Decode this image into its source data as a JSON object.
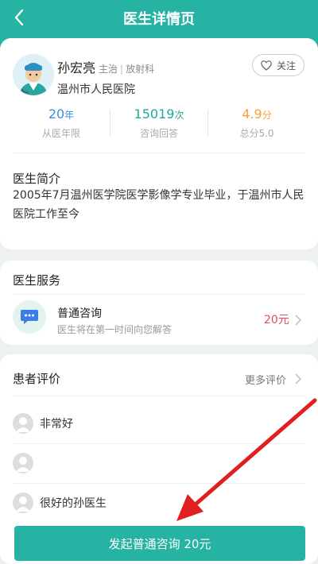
{
  "header": {
    "title": "医生详情页",
    "back_icon": "chevron-left-icon"
  },
  "doctor": {
    "name": "孙宏亮",
    "title": "主治",
    "department": "放射科",
    "hospital": "温州市人民医院",
    "follow_label": "关注"
  },
  "stats": [
    {
      "value": "20",
      "unit": "年",
      "label": "从医年限",
      "color": "#3b8fe0"
    },
    {
      "value": "15019",
      "unit": "次",
      "label": "咨询回答",
      "color": "#1ea99a"
    },
    {
      "value": "4.9",
      "unit": "分",
      "label": "总分5.0",
      "color": "#f2a23a"
    }
  ],
  "intro": {
    "title": "医生简介",
    "text": "2005年7月温州医学院医学影像学专业毕业，于温州市人民医院工作至今"
  },
  "services": {
    "title": "医生服务",
    "items": [
      {
        "name": "普通咨询",
        "desc": "医生将在第一时间向您解答",
        "price": "20元"
      }
    ]
  },
  "reviews": {
    "title": "患者评价",
    "more_label": "更多评价",
    "items": [
      {
        "text": "非常好"
      },
      {
        "text": ""
      },
      {
        "text": "很好的孙医生"
      }
    ]
  },
  "cta": {
    "label": "发起普通咨询 20元"
  },
  "colors": {
    "brand": "#26b3a3",
    "price": "#e8495e",
    "annotation_arrow": "#e02020"
  }
}
